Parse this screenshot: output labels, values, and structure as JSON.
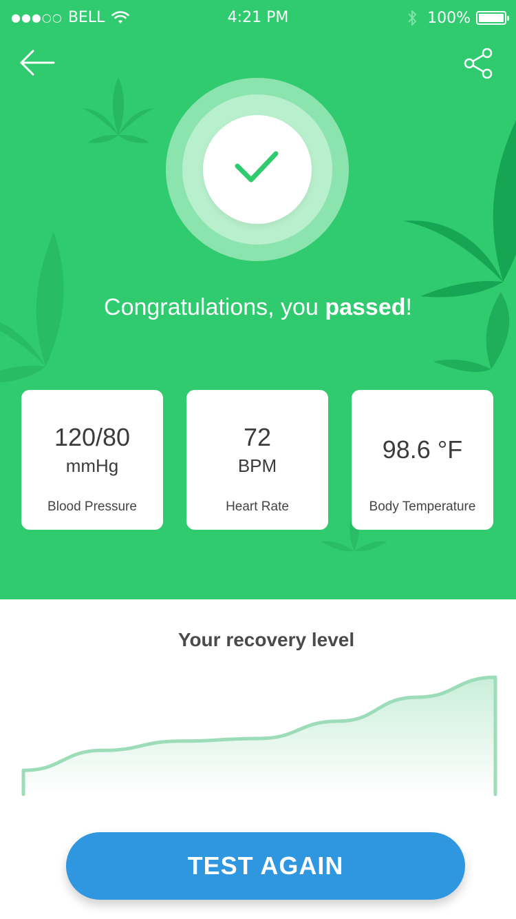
{
  "status_bar": {
    "signal": "●●●○○",
    "carrier": "BELL",
    "time": "4:21 PM",
    "battery_percent": "100%"
  },
  "header": {
    "back_icon": "arrow-left-icon",
    "share_icon": "share-icon"
  },
  "result": {
    "badge_icon": "checkmark-icon",
    "headline_prefix": "Congratulations, you ",
    "headline_bold": "passed",
    "headline_suffix": "!"
  },
  "vitals": [
    {
      "value": "120/80",
      "unit": "mmHg",
      "label": "Blood Pressure"
    },
    {
      "value": "72",
      "unit": "BPM",
      "label": "Heart Rate"
    },
    {
      "value": "98.6 °F",
      "unit": "",
      "label": "Body Temperature"
    }
  ],
  "recovery": {
    "title": "Your recovery level"
  },
  "chart_data": {
    "type": "area",
    "title": "Your recovery level",
    "xlabel": "",
    "ylabel": "",
    "x": [
      0,
      1,
      2,
      3,
      4,
      5,
      6
    ],
    "values": [
      18,
      33,
      40,
      42,
      55,
      73,
      88
    ],
    "ylim": [
      0,
      100
    ],
    "grid": false,
    "color": "#9ddcb8"
  },
  "actions": {
    "test_again_label": "TEST AGAIN"
  },
  "colors": {
    "hero_green": "#2fcb6e",
    "button_blue": "#2e97e0",
    "check_green": "#2fcb6e"
  }
}
